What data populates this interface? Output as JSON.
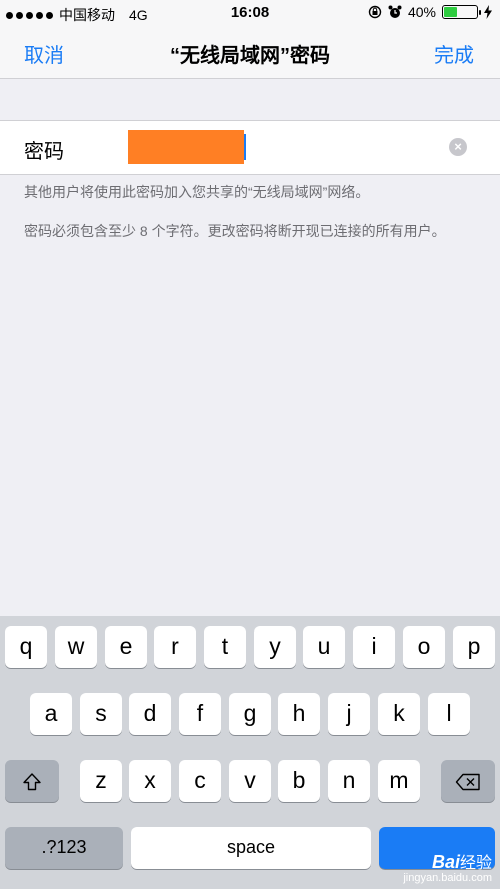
{
  "status_bar": {
    "carrier": "中国移动",
    "network": "4G",
    "time": "16:08",
    "battery_percent": "40%",
    "battery_level": 0.4
  },
  "nav": {
    "cancel_label": "取消",
    "title": "“无线局域网”密码",
    "done_label": "完成"
  },
  "password_field": {
    "label": "密码"
  },
  "notes": {
    "line1": "其他用户将使用此密码加入您共享的“无线局域网”网络。",
    "line2": "密码必须包含至少 8 个字符。更改密码将断开现已连接的所有用户。"
  },
  "keyboard": {
    "row1": [
      "q",
      "w",
      "e",
      "r",
      "t",
      "y",
      "u",
      "i",
      "o",
      "p"
    ],
    "row2": [
      "a",
      "s",
      "d",
      "f",
      "g",
      "h",
      "j",
      "k",
      "l"
    ],
    "row3": [
      "z",
      "x",
      "c",
      "v",
      "b",
      "n",
      "m"
    ],
    "numbers_label": ".?123",
    "space_label": "space",
    "accent_color": "#1a7cf5"
  },
  "watermark": {
    "brand": "Bai",
    "brand_suffix": "经验",
    "url": "jingyan.baidu.com"
  }
}
